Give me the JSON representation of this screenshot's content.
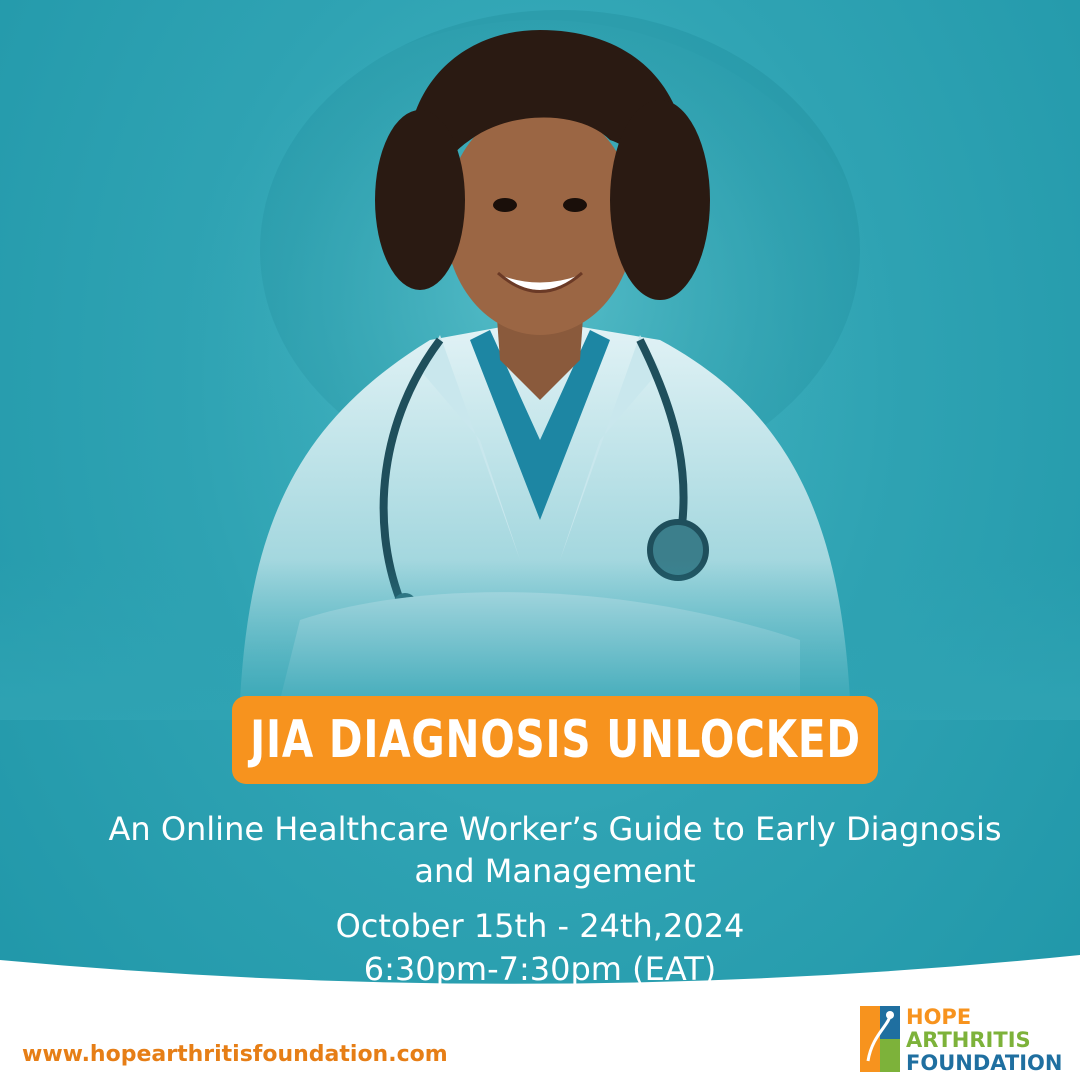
{
  "title": "JIA DIAGNOSIS UNLOCKED",
  "subtitle_line1": "An Online Healthcare Worker’s Guide to Early Diagnosis",
  "subtitle_line2": "and Management",
  "dates": "October 15th - 24th,2024",
  "time": "6:30pm-7:30pm (EAT)",
  "website": "www.hopearthritisfoundation.com",
  "logo": {
    "line1": "HOPE",
    "line2": "ARTHRITIS",
    "line3": "FOUNDATION"
  },
  "colors": {
    "background": "#2fa3b3",
    "accent_orange": "#f7931e",
    "logo_green": "#7db23a",
    "logo_blue": "#1f6fa0"
  }
}
